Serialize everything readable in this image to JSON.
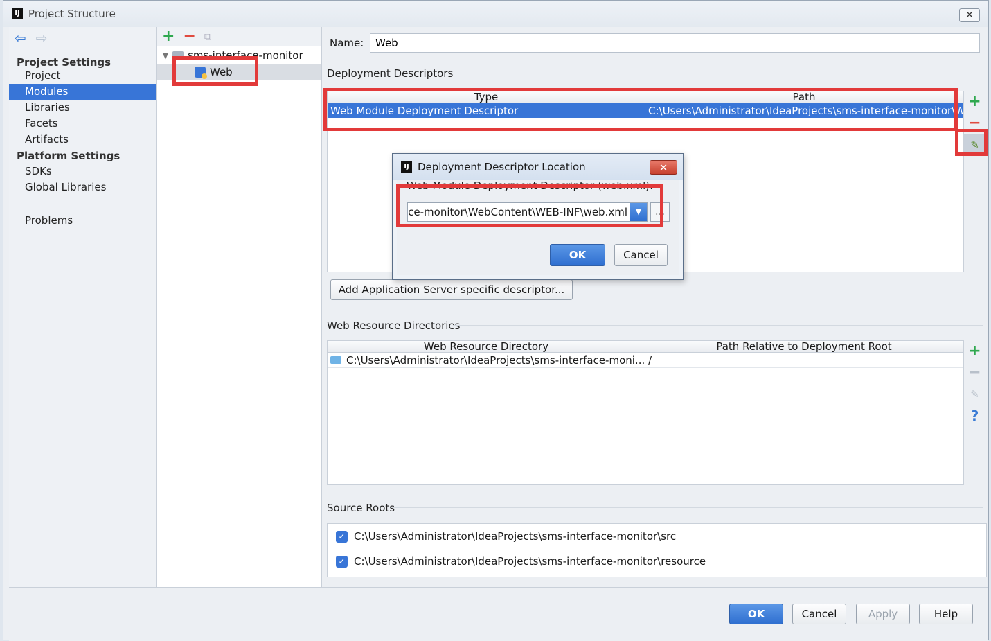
{
  "window": {
    "title": "Project Structure",
    "close_glyph": "✕"
  },
  "nav": {
    "back_glyph": "⇦",
    "forward_glyph": "⇨",
    "project_settings_header": "Project Settings",
    "project_settings_items": [
      "Project",
      "Modules",
      "Libraries",
      "Facets",
      "Artifacts"
    ],
    "platform_settings_header": "Platform Settings",
    "platform_settings_items": [
      "SDKs",
      "Global Libraries"
    ],
    "problems": "Problems",
    "selected": "Modules"
  },
  "tree": {
    "add_glyph": "+",
    "remove_glyph": "−",
    "copy_glyph": "⧉",
    "root_label": "sms-interface-monitor",
    "child_label": "Web"
  },
  "facet": {
    "name_label": "Name:",
    "name_value": "Web",
    "deployment_descriptors": {
      "title": "Deployment Descriptors",
      "columns": [
        "Type",
        "Path"
      ],
      "rows": [
        {
          "type": "Web Module Deployment Descriptor",
          "path": "C:\\Users\\Administrator\\IdeaProjects\\sms-interface-monitor\\W"
        }
      ]
    },
    "add_server_descriptor_button": "Add Application Server specific descriptor...",
    "web_resource_directories": {
      "title": "Web Resource Directories",
      "columns": [
        "Web Resource Directory",
        "Path Relative to Deployment Root"
      ],
      "rows": [
        {
          "directory": "C:\\Users\\Administrator\\IdeaProjects\\sms-interface-moni...",
          "relative": "/"
        }
      ]
    },
    "source_roots": {
      "title": "Source Roots",
      "items": [
        "C:\\Users\\Administrator\\IdeaProjects\\sms-interface-monitor\\src",
        "C:\\Users\\Administrator\\IdeaProjects\\sms-interface-monitor\\resource"
      ]
    }
  },
  "tools": {
    "add_glyph": "+",
    "remove_glyph": "−",
    "edit_glyph": "✎",
    "help_glyph": "?"
  },
  "dialog": {
    "title": "Deployment Descriptor Location",
    "close_glyph": "✕",
    "label": "Web Module Deployment Descriptor (web.xml):",
    "path_value": "ce-monitor\\WebContent\\WEB-INF\\web.xml",
    "dropdown_glyph": "▼",
    "browse_glyph": "...",
    "ok_button": "OK",
    "cancel_button": "Cancel"
  },
  "footer": {
    "ok_button": "OK",
    "cancel_button": "Cancel",
    "apply_button": "Apply",
    "help_button": "Help"
  }
}
